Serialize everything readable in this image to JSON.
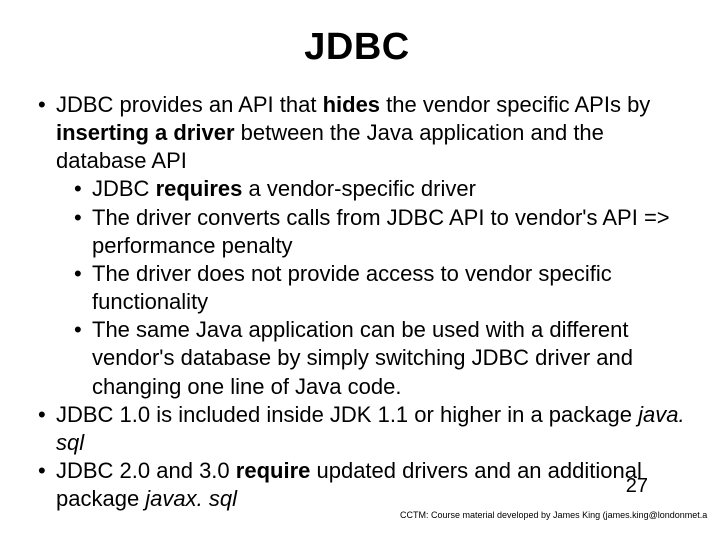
{
  "title": "JDBC",
  "bullets": {
    "b1_pre": "JDBC provides an API that ",
    "b1_em1": "hides",
    "b1_mid": " the vendor specific APIs by ",
    "b1_em2": "inserting a driver",
    "b1_post": " between the Java application and the database API",
    "b1_sub1_pre": "JDBC ",
    "b1_sub1_em": "requires",
    "b1_sub1_post": " a vendor-specific driver",
    "b1_sub2": "The driver converts calls from JDBC API to vendor's API => performance penalty",
    "b1_sub3": "The driver does not provide access to vendor specific functionality",
    "b1_sub4": "The same Java application can be used with a different vendor's database by simply switching JDBC driver and changing one line of Java code.",
    "b2_pre": "JDBC 1.0  is included inside JDK 1.1 or higher in a package ",
    "b2_it": "java. sql",
    "b3_pre": "JDBC 2.0 and 3.0 ",
    "b3_em": "require",
    "b3_mid": " updated drivers and an additional package ",
    "b3_it": "javax. sql"
  },
  "page_number": "27",
  "footer": "CCTM: Course material developed by James King (james.king@londonmet.a"
}
